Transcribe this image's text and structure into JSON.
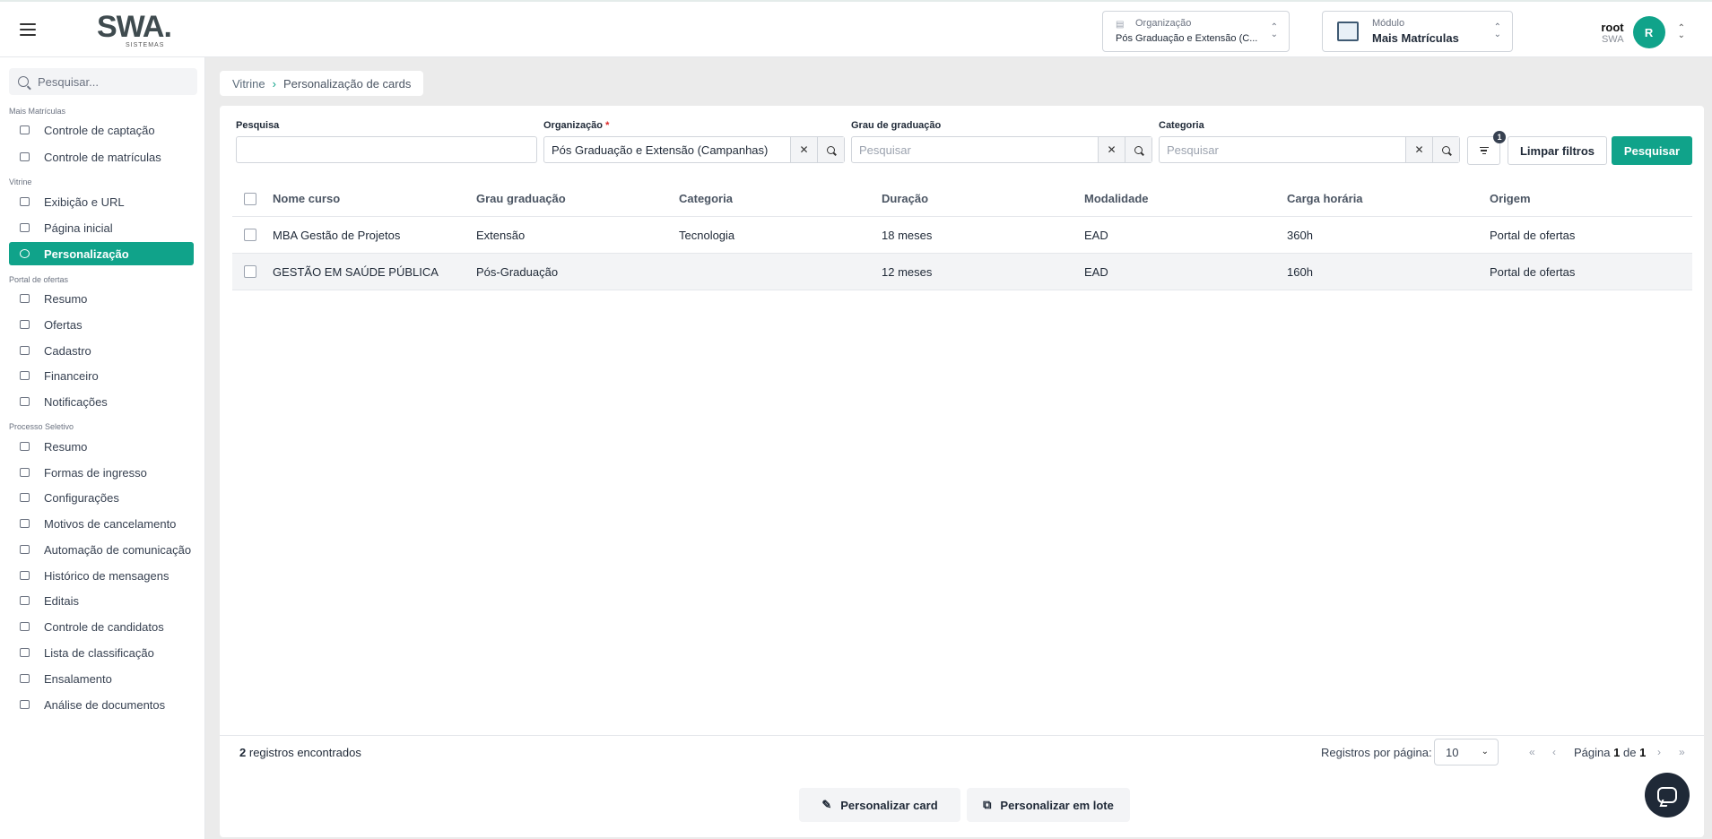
{
  "header": {
    "logo_text": "SWA.",
    "logo_sub": "SISTEMAS",
    "org_label": "Organização",
    "org_value": "Pós Graduação e Extensão (C...",
    "module_label": "Módulo",
    "module_value": "Mais Matrículas",
    "user_name": "root",
    "user_org": "SWA",
    "avatar_initial": "R"
  },
  "sidebar": {
    "search_placeholder": "Pesquisar...",
    "sections": [
      {
        "title": "Mais Matrículas",
        "items": [
          {
            "label": "Controle de captação",
            "icon": "user-plus-icon"
          },
          {
            "label": "Controle de matrículas",
            "icon": "document-icon"
          }
        ]
      },
      {
        "title": "Vitrine",
        "items": [
          {
            "label": "Exibição e URL",
            "icon": "store-icon"
          },
          {
            "label": "Página inicial",
            "icon": "layout-icon"
          },
          {
            "label": "Personalização",
            "icon": "palette-icon",
            "active": true
          }
        ]
      },
      {
        "title": "Portal de ofertas",
        "items": [
          {
            "label": "Resumo",
            "icon": "summary-icon"
          },
          {
            "label": "Ofertas",
            "icon": "cart-icon"
          },
          {
            "label": "Cadastro",
            "icon": "user-edit-icon"
          },
          {
            "label": "Financeiro",
            "icon": "dollar-icon"
          },
          {
            "label": "Notificações",
            "icon": "bell-icon"
          }
        ]
      },
      {
        "title": "Processo Seletivo",
        "items": [
          {
            "label": "Resumo",
            "icon": "summary-icon"
          },
          {
            "label": "Formas de ingresso",
            "icon": "form-icon"
          },
          {
            "label": "Configurações",
            "icon": "graduation-icon"
          },
          {
            "label": "Motivos de cancelamento",
            "icon": "cancel-list-icon"
          },
          {
            "label": "Automação de comunicação",
            "icon": "mail-icon"
          },
          {
            "label": "Histórico de mensagens",
            "icon": "chat-history-icon"
          },
          {
            "label": "Editais",
            "icon": "calendar-icon"
          },
          {
            "label": "Controle de candidatos",
            "icon": "candidates-icon"
          },
          {
            "label": "Lista de classificação",
            "icon": "list-icon"
          },
          {
            "label": "Ensalamento",
            "icon": "chair-icon"
          },
          {
            "label": "Análise de documentos",
            "icon": "doc-analysis-icon"
          }
        ]
      }
    ]
  },
  "breadcrumb": {
    "root": "Vitrine",
    "current": "Personalização de cards"
  },
  "filters": {
    "search_label": "Pesquisa",
    "search_value": "",
    "org_label": "Organização",
    "org_required": "*",
    "org_value": "Pós Graduação e Extensão (Campanhas)",
    "grau_label": "Grau de graduação",
    "grau_placeholder": "Pesquisar",
    "cat_label": "Categoria",
    "cat_placeholder": "Pesquisar",
    "filter_badge": "1",
    "clear_label": "Limpar filtros",
    "search_button": "Pesquisar"
  },
  "table": {
    "columns": [
      "Nome curso",
      "Grau graduação",
      "Categoria",
      "Duração",
      "Modalidade",
      "Carga horária",
      "Origem"
    ],
    "rows": [
      [
        "MBA Gestão de Projetos",
        "Extensão",
        "Tecnologia",
        "18 meses",
        "EAD",
        "360h",
        "Portal de ofertas"
      ],
      [
        "GESTÃO EM SAÚDE PÚBLICA",
        "Pós-Graduação",
        "",
        "12 meses",
        "EAD",
        "160h",
        "Portal de ofertas"
      ]
    ]
  },
  "footer": {
    "count": "2",
    "count_label": "registros encontrados",
    "per_page_label": "Registros por página:",
    "per_page_value": "10",
    "page_prefix": "Página",
    "page_current": "1",
    "page_of": "de",
    "page_total": "1"
  },
  "actions": {
    "customize_card": "Personalizar card",
    "customize_batch": "Personalizar em lote"
  }
}
